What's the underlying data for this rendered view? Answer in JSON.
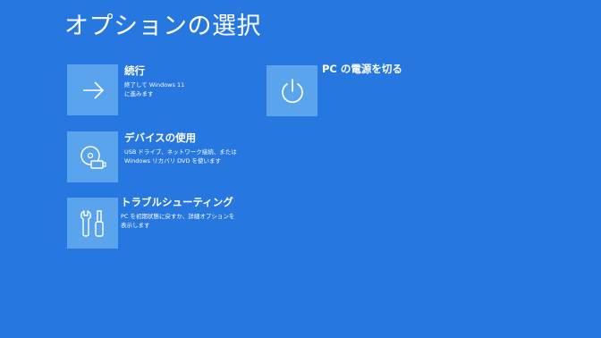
{
  "page": {
    "title": "オプションの選択"
  },
  "colors": {
    "background": "#2777e0",
    "tile": "#5aa4ee",
    "text": "#ffffff"
  },
  "options": [
    {
      "label": "続行",
      "description_lines": [
        "終了して Windows 11",
        "に進みます"
      ],
      "icon": "arrow-right-icon"
    },
    {
      "label": "デバイスの使用",
      "description_lines": [
        "USB ドライブ、ネットワーク接続、または",
        "Windows リカバリ DVD を使います"
      ],
      "icon": "disc-usb-icon"
    },
    {
      "label": "トラブルシューティング",
      "description_lines": [
        "PC を初期状態に戻すか、詳細オプションを",
        "表示します"
      ],
      "icon": "tools-icon"
    },
    {
      "label": "PC の電源を切る",
      "description_lines": [],
      "icon": "power-icon"
    }
  ]
}
